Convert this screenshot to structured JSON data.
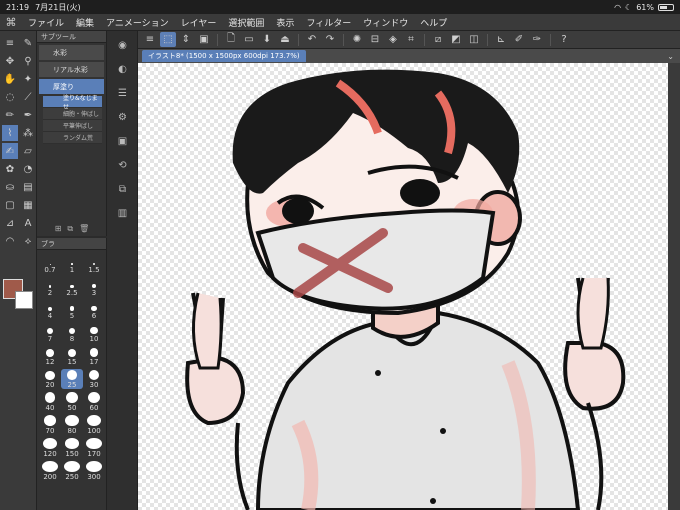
{
  "status": {
    "time": "21:19",
    "date": "7月21日(火)",
    "battery": "61%",
    "battery_level": 0.61
  },
  "menu": {
    "items": [
      "ファイル",
      "編集",
      "アニメーション",
      "レイヤー",
      "選択範囲",
      "表示",
      "フィルター",
      "ウィンドウ",
      "ヘルプ"
    ]
  },
  "toolbar_icons": [
    "menu-icon",
    "select-icon",
    "chevron-icon",
    "snapshot-icon",
    "new-file-icon",
    "open-folder-icon",
    "save-icon",
    "export-icon",
    "undo-icon",
    "redo-icon",
    "loading-icon",
    "clear-icon",
    "fill-icon",
    "crop-icon",
    "transform-icon",
    "deselect-icon",
    "invert-icon",
    "ruler-icon",
    "brush-settings-icon",
    "help-icon"
  ],
  "canvas_tab": {
    "title": "イラスト8* (1500 x 1500px 600dpi 173.7%)"
  },
  "subtool": {
    "header": "サブツール",
    "tools": [
      {
        "label": "水彩",
        "selected": false
      },
      {
        "label": "リアル水彩",
        "selected": false
      },
      {
        "label": "厚塗り",
        "selected": true
      }
    ],
    "brushes": [
      {
        "label": "塗り&なじませ",
        "selected": true
      },
      {
        "label": "細胞・伸ばし",
        "selected": false
      },
      {
        "label": "平筆伸ばし",
        "selected": false
      },
      {
        "label": "ランダム荒",
        "selected": false
      }
    ]
  },
  "brush_size": {
    "header": "ブラ",
    "sizes": [
      "0.7",
      "1",
      "1.5",
      "2",
      "2.5",
      "3",
      "4",
      "5",
      "6",
      "7",
      "8",
      "10",
      "12",
      "15",
      "17",
      "20",
      "25",
      "30",
      "40",
      "50",
      "60",
      "70",
      "80",
      "100",
      "120",
      "150",
      "170",
      "200",
      "250",
      "300"
    ],
    "selected": "25"
  },
  "colors": {
    "main": "#a05a4a",
    "sub": "#ffffff",
    "accent": "#5a7fb8"
  }
}
